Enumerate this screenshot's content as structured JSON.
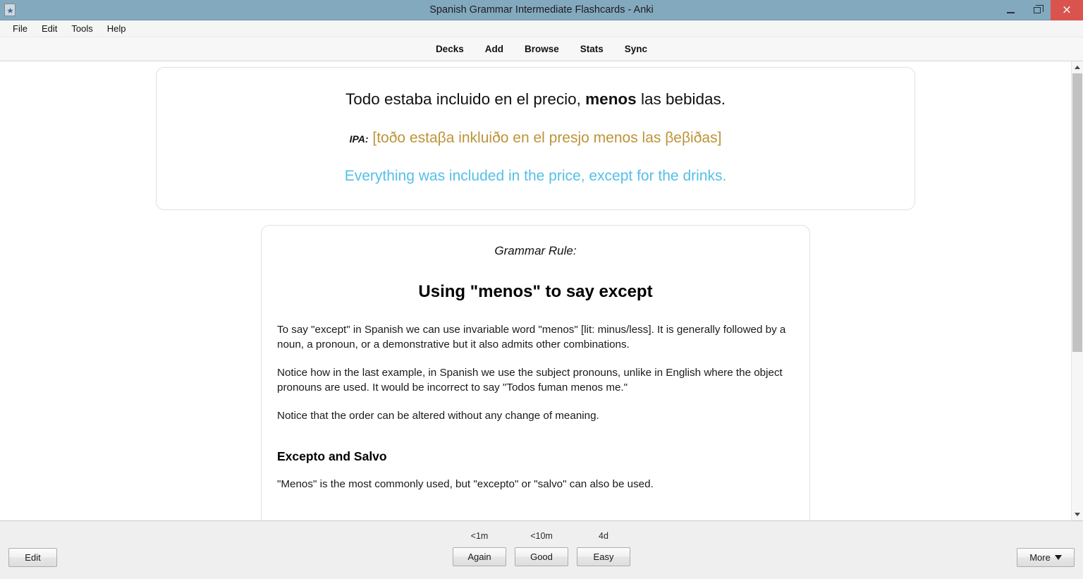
{
  "window": {
    "title": "Spanish Grammar Intermediate Flashcards - Anki",
    "app_icon": "anki-icon",
    "controls": {
      "minimize": "minimize-icon",
      "maximize": "restore-icon",
      "close": "×"
    }
  },
  "menubar": {
    "items": [
      {
        "label": "File"
      },
      {
        "label": "Edit"
      },
      {
        "label": "Tools"
      },
      {
        "label": "Help"
      }
    ]
  },
  "navbar": {
    "links": [
      {
        "label": "Decks"
      },
      {
        "label": "Add"
      },
      {
        "label": "Browse"
      },
      {
        "label": "Stats"
      },
      {
        "label": "Sync"
      }
    ]
  },
  "card_front": {
    "sentence_before": "Todo estaba incluido en el precio, ",
    "sentence_bold": "menos",
    "sentence_after": " las bebidas.",
    "ipa_label": "IPA:",
    "ipa_text": "[toðo estaβa inkluiðo en el presjo menos las βeβiðas]",
    "translation": "Everything was included in the price, except for the drinks.",
    "colors": {
      "ipa": "#bd9437",
      "translation": "#55bfe8"
    }
  },
  "card_rule": {
    "label": "Grammar Rule:",
    "title": "Using \"menos\" to say except",
    "paragraphs": [
      "To say \"except\" in Spanish we can use invariable word \"menos\" [lit: minus/less]. It is generally followed by a noun, a pronoun, or a demonstrative but it also admits other combinations.",
      "Notice how in the last example, in Spanish we use the subject pronouns, unlike in English where the object pronouns are used. It would be incorrect to say \"Todos fuman menos me.\"",
      "Notice that the order can be altered without any change of meaning."
    ],
    "subheading": "Excepto and Salvo",
    "subheading_paragraph": "\"Menos\" is the most commonly used, but \"excepto\" or \"salvo\" can also be used."
  },
  "scrollbar": {
    "up_icon": "scroll-up-icon",
    "down_icon": "scroll-down-icon",
    "thumb_position_percent": 0,
    "thumb_size_percent": 64
  },
  "bottombar": {
    "edit_label": "Edit",
    "more_label": "More",
    "more_caret": "caret-down-icon",
    "answers": [
      {
        "interval": "<1m",
        "label": "Again"
      },
      {
        "interval": "<10m",
        "label": "Good"
      },
      {
        "interval": "4d",
        "label": "Easy"
      }
    ]
  }
}
